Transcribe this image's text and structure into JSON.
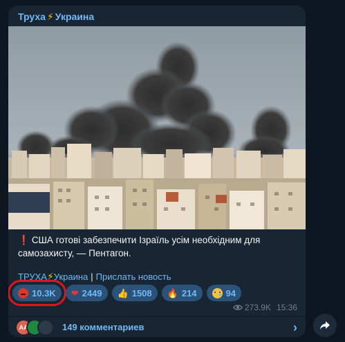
{
  "channel": {
    "name_part1": "Труха",
    "bolt": "⚡",
    "name_part2": "Украина"
  },
  "photo": {
    "subject": "smoke plumes over dense city buildings"
  },
  "post": {
    "alert_icon": "❗",
    "text": "США готові забезпечити Ізраїль усім необхідним для самозахисту, — Пентагон.",
    "footer_channel_part1": "ТРУХА",
    "footer_bolt": "⚡",
    "footer_channel_part2": "Украина",
    "footer_separator": "|",
    "footer_link": "Прислать новость"
  },
  "reactions": [
    {
      "emoji_name": "angry-face-icon",
      "count": "10.3K"
    },
    {
      "emoji_name": "heart-icon",
      "emoji": "❤",
      "count": "2449"
    },
    {
      "emoji_name": "thumbs-up-icon",
      "emoji": "👍",
      "count": "1508"
    },
    {
      "emoji_name": "fire-icon",
      "emoji": "🔥",
      "count": "214"
    },
    {
      "emoji_name": "crying-face-icon",
      "count": "94"
    }
  ],
  "meta": {
    "views": "273.9K",
    "time": "15:36"
  },
  "comments": {
    "avatar_initials": "AA",
    "label": "149 комментариев"
  },
  "colors": {
    "accent": "#71baf5",
    "bubble": "#182533",
    "background": "#0e1621",
    "reaction_pill": "#2b5278",
    "highlight_box": "#e0161c"
  }
}
